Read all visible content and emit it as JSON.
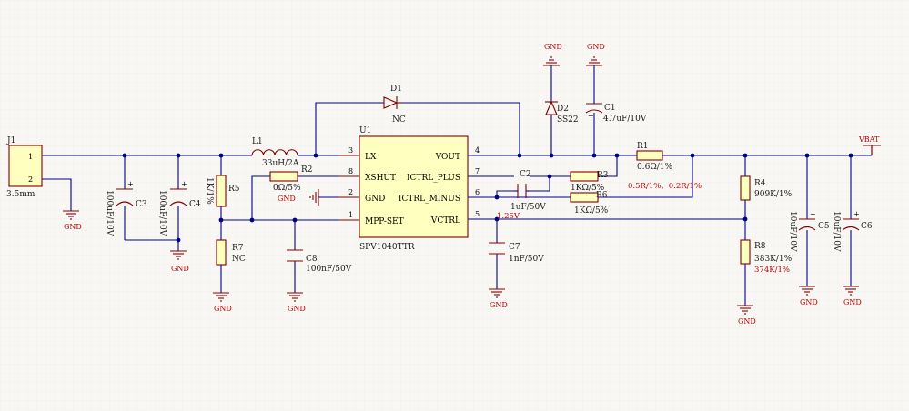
{
  "colors": {
    "wire": "#00008b",
    "part": "#800000",
    "net_label": "#c00000",
    "chip_fill": "#ffffc0",
    "junction": "#00008b"
  },
  "connector": {
    "ref": "J1",
    "pin1": "1",
    "pin2": "2",
    "value": "3.5mm"
  },
  "chip": {
    "ref": "U1",
    "part_number": "SPV1040TTR",
    "pins_left": [
      {
        "num": "3",
        "name": "LX"
      },
      {
        "num": "8",
        "name": "XSHUT"
      },
      {
        "num": "2",
        "name": "GND"
      },
      {
        "num": "1",
        "name": "MPP-SET"
      }
    ],
    "pins_right": [
      {
        "num": "4",
        "name": "VOUT"
      },
      {
        "num": "7",
        "name": "ICTRL_PLUS"
      },
      {
        "num": "6",
        "name": "ICTRL_MINUS"
      },
      {
        "num": "5",
        "name": "VCTRL"
      }
    ]
  },
  "components": {
    "C3": {
      "ref": "C3",
      "value": "100uF/10V"
    },
    "C4": {
      "ref": "C4",
      "value": "100uF/10V"
    },
    "L1": {
      "ref": "L1",
      "value": "33uH/2A"
    },
    "R5": {
      "ref": "R5",
      "value": "1K/1%"
    },
    "R7": {
      "ref": "R7",
      "value": "NC"
    },
    "R2": {
      "ref": "R2",
      "value": "0Ω/5%"
    },
    "C8": {
      "ref": "C8",
      "value": "100nF/50V"
    },
    "D1": {
      "ref": "D1",
      "value": "NC"
    },
    "D2": {
      "ref": "D2",
      "value": "SS22"
    },
    "C1": {
      "ref": "C1",
      "value": "4.7uF/10V"
    },
    "C2": {
      "ref": "C2",
      "value": "1uF/50V"
    },
    "R3": {
      "ref": "R3",
      "value": "1KΩ/5%"
    },
    "R6": {
      "ref": "R6",
      "value": "1KΩ/5%"
    },
    "R1": {
      "ref": "R1",
      "value": "0.6Ω/1%",
      "note": "0.5R/1%、0.2R/1%"
    },
    "C7": {
      "ref": "C7",
      "value": "1nF/50V"
    },
    "R4": {
      "ref": "R4",
      "value": "909K/1%"
    },
    "R8": {
      "ref": "R8",
      "value": "383K/1%",
      "note": "374K/1%"
    },
    "C5": {
      "ref": "C5",
      "value": "10uF/10V"
    },
    "C6": {
      "ref": "C6",
      "value": "10uF/10V"
    }
  },
  "nets": {
    "gnd": "GND",
    "vbat": "VBAT",
    "vctrl_voltage": "1.25V"
  }
}
